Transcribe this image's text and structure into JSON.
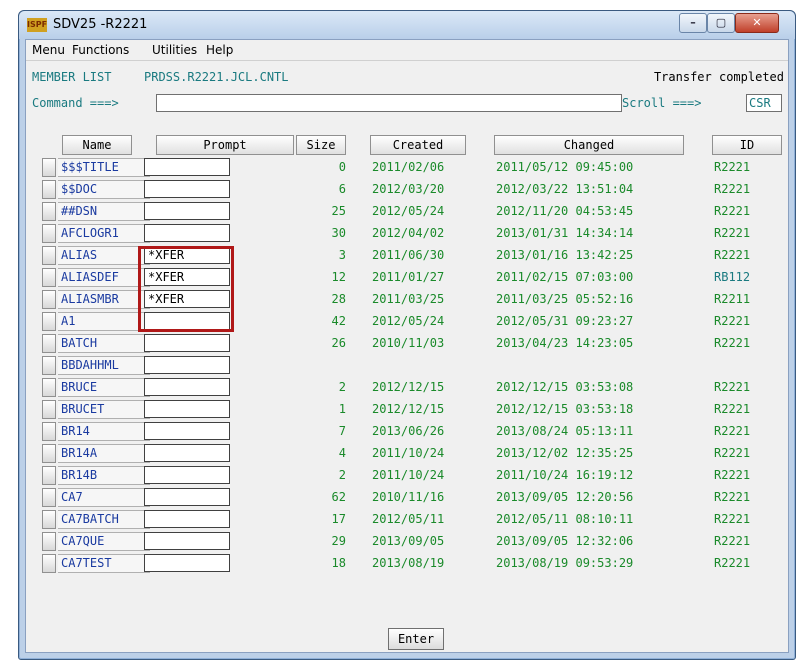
{
  "window": {
    "title": "SDV25 -R2221",
    "icon_text": "ISPF"
  },
  "menu": [
    "Menu",
    "Functions",
    "Utilities",
    "Help"
  ],
  "header": {
    "label": "MEMBER LIST",
    "dataset": "PRDSS.R2221.JCL.CNTL",
    "status": "Transfer completed"
  },
  "command": {
    "label": "Command ===>",
    "value": "",
    "scroll_label": "Scroll ===>",
    "scroll_value": "CSR"
  },
  "columns": {
    "name": "Name",
    "prompt": "Prompt",
    "size": "Size",
    "created": "Created",
    "changed": "Changed",
    "id": "ID"
  },
  "rows": [
    {
      "name": "$$$TITLE",
      "prompt": "",
      "size": "0",
      "created": "2011/02/06",
      "changed": "2011/05/12 09:45:00",
      "id": "R2221"
    },
    {
      "name": "$$DOC",
      "prompt": "",
      "size": "6",
      "created": "2012/03/20",
      "changed": "2012/03/22 13:51:04",
      "id": "R2221"
    },
    {
      "name": "##DSN",
      "prompt": "",
      "size": "25",
      "created": "2012/05/24",
      "changed": "2012/11/20 04:53:45",
      "id": "R2221"
    },
    {
      "name": "AFCLOGR1",
      "prompt": "",
      "size": "30",
      "created": "2012/04/02",
      "changed": "2013/01/31 14:34:14",
      "id": "R2221"
    },
    {
      "name": "ALIAS",
      "prompt": "*XFER",
      "size": "3",
      "created": "2011/06/30",
      "changed": "2013/01/16 13:42:25",
      "id": "R2221"
    },
    {
      "name": "ALIASDEF",
      "prompt": "*XFER",
      "size": "12",
      "created": "2011/01/27",
      "changed": "2011/02/15 07:03:00",
      "id": "RB112"
    },
    {
      "name": "ALIASMBR",
      "prompt": "*XFER",
      "size": "28",
      "created": "2011/03/25",
      "changed": "2011/03/25 05:52:16",
      "id": "R2211"
    },
    {
      "name": "A1",
      "prompt": "",
      "size": "42",
      "created": "2012/05/24",
      "changed": "2012/05/31 09:23:27",
      "id": "R2221"
    },
    {
      "name": "BATCH",
      "prompt": "",
      "size": "26",
      "created": "2010/11/03",
      "changed": "2013/04/23 14:23:05",
      "id": "R2221"
    },
    {
      "name": "BBDAHHML",
      "prompt": "",
      "size": "",
      "created": "",
      "changed": "",
      "id": ""
    },
    {
      "name": "BRUCE",
      "prompt": "",
      "size": "2",
      "created": "2012/12/15",
      "changed": "2012/12/15 03:53:08",
      "id": "R2221"
    },
    {
      "name": "BRUCET",
      "prompt": "",
      "size": "1",
      "created": "2012/12/15",
      "changed": "2012/12/15 03:53:18",
      "id": "R2221"
    },
    {
      "name": "BR14",
      "prompt": "",
      "size": "7",
      "created": "2013/06/26",
      "changed": "2013/08/24 05:13:11",
      "id": "R2221"
    },
    {
      "name": "BR14A",
      "prompt": "",
      "size": "4",
      "created": "2011/10/24",
      "changed": "2013/12/02 12:35:25",
      "id": "R2221"
    },
    {
      "name": "BR14B",
      "prompt": "",
      "size": "2",
      "created": "2011/10/24",
      "changed": "2011/10/24 16:19:12",
      "id": "R2221"
    },
    {
      "name": "CA7",
      "prompt": "",
      "size": "62",
      "created": "2010/11/16",
      "changed": "2013/09/05 12:20:56",
      "id": "R2221"
    },
    {
      "name": "CA7BATCH",
      "prompt": "",
      "size": "17",
      "created": "2012/05/11",
      "changed": "2012/05/11 08:10:11",
      "id": "R2221"
    },
    {
      "name": "CA7QUE",
      "prompt": "",
      "size": "29",
      "created": "2013/09/05",
      "changed": "2013/09/05 12:32:06",
      "id": "R2221"
    },
    {
      "name": "CA7TEST",
      "prompt": "",
      "size": "18",
      "created": "2013/08/19",
      "changed": "2013/08/19 09:53:29",
      "id": "R2221"
    }
  ],
  "enter_label": "Enter",
  "colors": {
    "green": "#1a8a2a",
    "teal": "#1a7a80",
    "highlight": "#b01818"
  }
}
